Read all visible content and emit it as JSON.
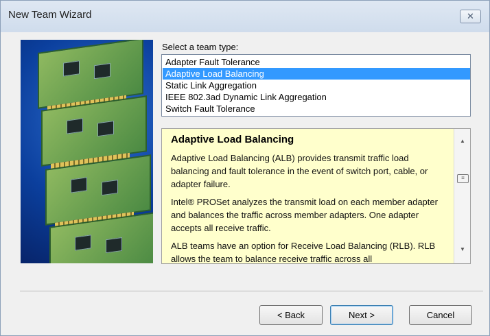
{
  "window": {
    "title": "New Team Wizard",
    "close_glyph": "✕"
  },
  "prompt": "Select a team type:",
  "team_types": [
    "Adapter Fault Tolerance",
    "Adaptive Load Balancing",
    "Static Link Aggregation",
    "IEEE 802.3ad Dynamic Link Aggregation",
    "Switch Fault Tolerance"
  ],
  "selected_team_type": "Adaptive Load Balancing",
  "description": {
    "title": "Adaptive Load Balancing",
    "paragraphs": [
      "Adaptive Load Balancing (ALB) provides transmit traffic load balancing and fault tolerance in the event of switch port, cable, or adapter failure.",
      "Intel® PROSet analyzes the transmit load on each member adapter and balances the traffic across member adapters. One adapter accepts all receive traffic.",
      "ALB teams have an option for Receive Load Balancing (RLB). RLB allows the team to balance receive traffic across all"
    ]
  },
  "scroll_icons": {
    "up": "▲",
    "down": "▼",
    "thumb": "≡"
  },
  "buttons": {
    "back": "< Back",
    "next": "Next >",
    "cancel": "Cancel"
  }
}
